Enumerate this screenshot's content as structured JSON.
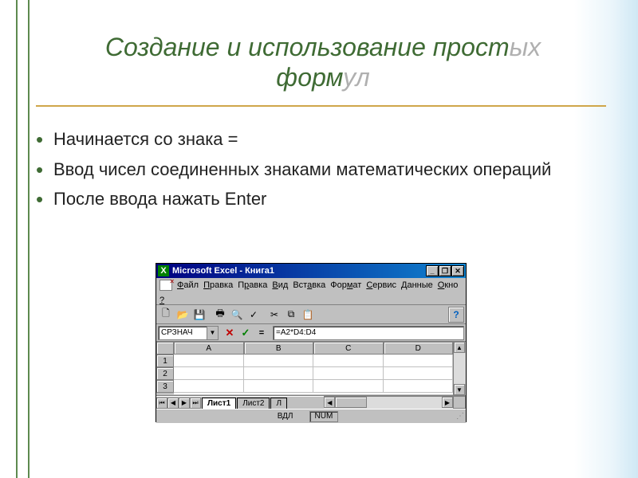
{
  "title": {
    "part1": "Создание и использование прост",
    "part1_grey": "ых",
    "part2": "форм",
    "part2_grey": "ул"
  },
  "bullets": [
    "Начинается со знака =",
    "Ввод чисел соединенных знаками математических операций",
    "После ввода нажать Enter"
  ],
  "excel": {
    "titlebar_icon": "X",
    "titlebar": "Microsoft Excel - Книга1",
    "win_buttons": {
      "min": "_",
      "max": "❐",
      "close": "✕"
    },
    "menu": [
      "Файл",
      "Правка",
      "Правка",
      "Вид",
      "Вставка",
      "Формат",
      "Сервис",
      "Данные",
      "Окно",
      "?"
    ],
    "namebox": "СРЗНАЧ",
    "formula_buttons": {
      "cancel": "✕",
      "enter": "✓",
      "fx": "="
    },
    "formula": "=A2*D4:D4",
    "columns": [
      "A",
      "B",
      "C",
      "D"
    ],
    "rows": [
      "1",
      "2",
      "3"
    ],
    "sheet_nav": [
      "⏮",
      "◀",
      "▶",
      "⏭"
    ],
    "sheets": [
      {
        "name": "Лист1",
        "active": true
      },
      {
        "name": "Лист2",
        "active": false
      },
      {
        "name": "Л",
        "active": false
      }
    ],
    "status_left": "",
    "status_mid": "ВДЛ",
    "status_num": "NUM"
  }
}
